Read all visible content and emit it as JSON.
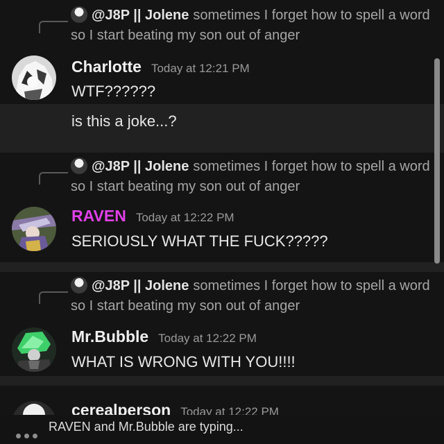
{
  "messages": [
    {
      "reply": {
        "author": "@J8P || Jolene",
        "text": "sometimes I forget how to spell a word so I start beating my son out of anger"
      },
      "author": "Charlotte",
      "author_color": "#f0f0f0",
      "timestamp": "Today at 12:21 PM",
      "lines": [
        "WTF??????",
        "is this a joke...?"
      ]
    },
    {
      "reply": {
        "author": "@J8P || Jolene",
        "text": "sometimes I forget how to spell a word so I start beating my son out of anger"
      },
      "author": "RAVEN",
      "author_color": "#e040e8",
      "timestamp": "Today at 12:22 PM",
      "lines": [
        "SERIOUSLY WHAT THE FUCK?????"
      ]
    },
    {
      "reply": {
        "author": "@J8P || Jolene",
        "text": "sometimes I forget how to spell a word so I start beating my son out of anger"
      },
      "author": "Mr.Bubble",
      "author_color": "#f0f0f0",
      "timestamp": "Today at 12:22 PM",
      "lines": [
        "WHAT IS WRONG WITH YOU!!!!"
      ]
    },
    {
      "author": "cerealperson",
      "author_color": "#f0f0f0",
      "timestamp": "Today at 12:22 PM"
    }
  ],
  "typing_indicator": "RAVEN and Mr.Bubble are typing..."
}
